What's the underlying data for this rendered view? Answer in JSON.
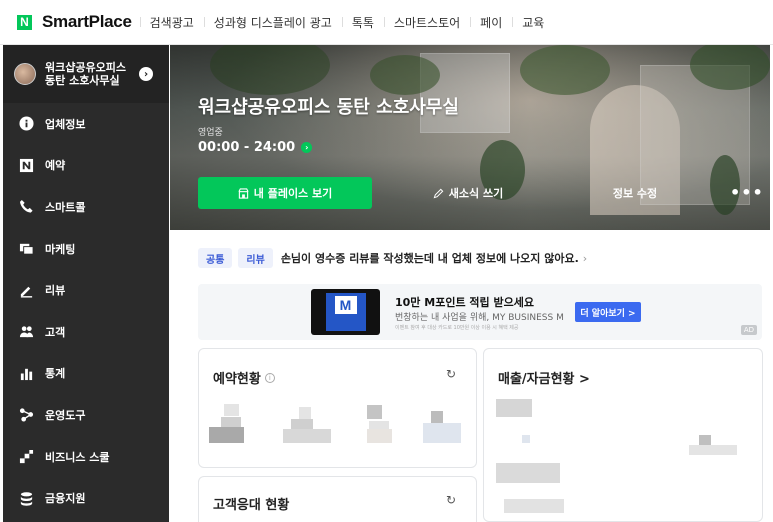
{
  "brand": {
    "logo_letter": "N",
    "name": "SmartPlace",
    "accent": "#03c75a"
  },
  "topnav": [
    "검색광고",
    "성과형 디스플레이 광고",
    "톡톡",
    "스마트스토어",
    "페이",
    "교육"
  ],
  "sidebar": {
    "business_name": "워크샵공유오피스 동탄 소호사무실",
    "items": [
      {
        "label": "업체정보",
        "icon": "info-icon"
      },
      {
        "label": "예약",
        "icon": "n-booking-icon"
      },
      {
        "label": "스마트콜",
        "icon": "phone-icon"
      },
      {
        "label": "마케팅",
        "icon": "cards-icon"
      },
      {
        "label": "리뷰",
        "icon": "pencil-icon"
      },
      {
        "label": "고객",
        "icon": "people-icon"
      },
      {
        "label": "통계",
        "icon": "bar-chart-icon"
      },
      {
        "label": "운영도구",
        "icon": "share-nodes-icon"
      },
      {
        "label": "비즈니스 스쿨",
        "icon": "steps-icon"
      },
      {
        "label": "금융지원",
        "icon": "coins-icon"
      }
    ]
  },
  "hero": {
    "title": "워크샵공유오피스 동탄 소호사무실",
    "status": "영업중",
    "hours": "00:00 - 24:00",
    "buttons": {
      "my_place": "내 플레이스 보기",
      "new_post": "새소식 쓰기",
      "edit_info": "정보 수정",
      "more": "•••"
    }
  },
  "notice": {
    "tags": [
      "공통",
      "리뷰"
    ],
    "text": "손님이 영수증 리뷰를 작성했는데 내 업체 정보에 나오지 않아요."
  },
  "ad": {
    "title": "10만 M포인트 적립 받으세요",
    "subtitle": "번창하는 내 사업을 위해, MY BUSINESS M",
    "fine_print": "이벤트 참여 후 대상 카드로 10만원 이상 이용 시 혜택 제공",
    "button": "더 알아보기 >",
    "badge": "AD",
    "card_letter": "M"
  },
  "cards": {
    "reservation": {
      "title": "예약현황"
    },
    "sales": {
      "title": "매출/자금현황 >"
    },
    "customer_service": {
      "title": "고객응대 현황"
    }
  }
}
